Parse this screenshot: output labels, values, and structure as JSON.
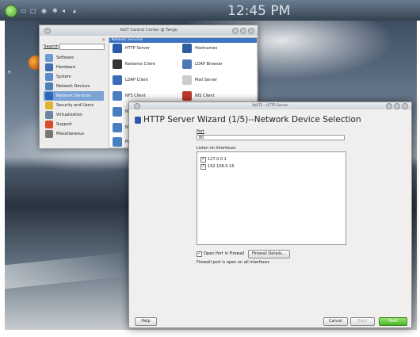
{
  "panel": {
    "clock": "12:45 PM"
  },
  "desktop": {
    "icon_label": "Fi"
  },
  "control_center": {
    "title": "YaST Control Center @ Tango",
    "search_label": "Search",
    "categories": [
      {
        "label": "Software",
        "color": "#6d9bd1"
      },
      {
        "label": "Hardware",
        "color": "#3f6fb0"
      },
      {
        "label": "System",
        "color": "#5b8acb"
      },
      {
        "label": "Network Devices",
        "color": "#4d7fb8"
      },
      {
        "label": "Network Services",
        "color": "#2c65b5"
      },
      {
        "label": "Security and Users",
        "color": "#e1b530"
      },
      {
        "label": "Virtualization",
        "color": "#6b86a3"
      },
      {
        "label": "Support",
        "color": "#d84b2c"
      },
      {
        "label": "Miscellaneous",
        "color": "#777777"
      }
    ],
    "group_header": "Network Services",
    "modules_left": [
      {
        "label": "HTTP Server",
        "color": "#2a5aa8"
      },
      {
        "label": "Kerberos Client",
        "color": "#333333"
      },
      {
        "label": "LDAP Client",
        "color": "#3a6db5"
      },
      {
        "label": "NFS Client",
        "color": "#4a7fbf"
      },
      {
        "label": "Ne",
        "color": "#4a7fbf"
      },
      {
        "label": "Ne",
        "color": "#4a7fbf"
      },
      {
        "label": "Pr",
        "color": "#4a7fbf"
      },
      {
        "label": "TA",
        "color": "#4a7fbf"
      }
    ],
    "modules_right": [
      {
        "label": "Hostnames",
        "color": "#2d5f9e"
      },
      {
        "label": "LDAP Browser",
        "color": "#4d77b4"
      },
      {
        "label": "Mail Server",
        "color": "#cccccc"
      },
      {
        "label": "NIS Client",
        "color": "#c0392b"
      }
    ]
  },
  "http_window": {
    "title": "YaST2 - HTTP Server",
    "heading": "HTTP Server Wizard (1/5)--Network Device Selection",
    "port_label": "Port",
    "port_value": "80",
    "interfaces_label": "Listen on Interfaces",
    "interfaces": [
      {
        "address": "127.0.0.1",
        "checked": "✓"
      },
      {
        "address": "192.168.0.16",
        "checked": "✓"
      }
    ],
    "firewall_checkbox_label": "Open Port in Firewall",
    "firewall_checked": "✓",
    "firewall_details_label": "Firewall Details...",
    "firewall_status": "Firewall port is open on all interfaces",
    "help_label": "Help",
    "cancel_label": "Cancel",
    "back_label": "Back",
    "next_label": "Next"
  }
}
